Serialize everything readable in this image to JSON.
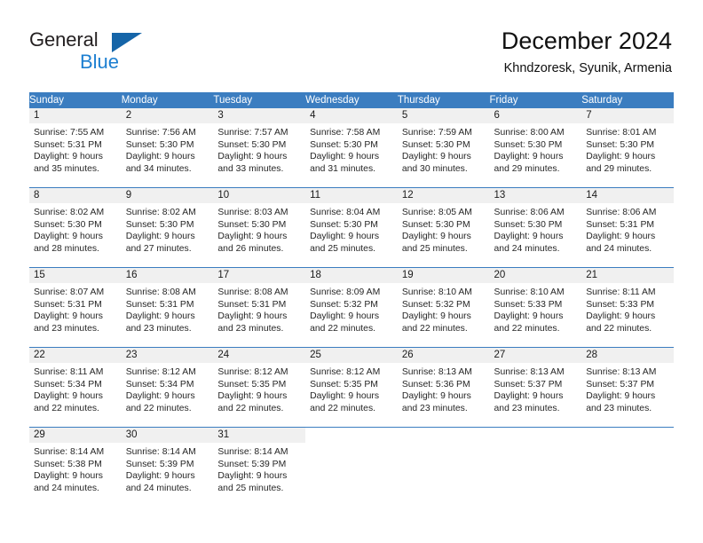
{
  "brand": {
    "line1": "General",
    "line2": "Blue",
    "triangle_icon": "blue-triangle-logo-mark",
    "color_dark": "#231f20",
    "color_blue": "#1c7fd1"
  },
  "header": {
    "title": "December 2024",
    "subtitle": "Khndzoresk, Syunik, Armenia"
  },
  "theme": {
    "header_blue": "#3b7dc0",
    "daynum_band": "#f0f0f0",
    "text": "#262626"
  },
  "weekdays": [
    "Sunday",
    "Monday",
    "Tuesday",
    "Wednesday",
    "Thursday",
    "Friday",
    "Saturday"
  ],
  "weeks": [
    [
      {
        "day": "1",
        "l1": "Sunrise: 7:55 AM",
        "l2": "Sunset: 5:31 PM",
        "l3": "Daylight: 9 hours",
        "l4": "and 35 minutes."
      },
      {
        "day": "2",
        "l1": "Sunrise: 7:56 AM",
        "l2": "Sunset: 5:30 PM",
        "l3": "Daylight: 9 hours",
        "l4": "and 34 minutes."
      },
      {
        "day": "3",
        "l1": "Sunrise: 7:57 AM",
        "l2": "Sunset: 5:30 PM",
        "l3": "Daylight: 9 hours",
        "l4": "and 33 minutes."
      },
      {
        "day": "4",
        "l1": "Sunrise: 7:58 AM",
        "l2": "Sunset: 5:30 PM",
        "l3": "Daylight: 9 hours",
        "l4": "and 31 minutes."
      },
      {
        "day": "5",
        "l1": "Sunrise: 7:59 AM",
        "l2": "Sunset: 5:30 PM",
        "l3": "Daylight: 9 hours",
        "l4": "and 30 minutes."
      },
      {
        "day": "6",
        "l1": "Sunrise: 8:00 AM",
        "l2": "Sunset: 5:30 PM",
        "l3": "Daylight: 9 hours",
        "l4": "and 29 minutes."
      },
      {
        "day": "7",
        "l1": "Sunrise: 8:01 AM",
        "l2": "Sunset: 5:30 PM",
        "l3": "Daylight: 9 hours",
        "l4": "and 29 minutes."
      }
    ],
    [
      {
        "day": "8",
        "l1": "Sunrise: 8:02 AM",
        "l2": "Sunset: 5:30 PM",
        "l3": "Daylight: 9 hours",
        "l4": "and 28 minutes."
      },
      {
        "day": "9",
        "l1": "Sunrise: 8:02 AM",
        "l2": "Sunset: 5:30 PM",
        "l3": "Daylight: 9 hours",
        "l4": "and 27 minutes."
      },
      {
        "day": "10",
        "l1": "Sunrise: 8:03 AM",
        "l2": "Sunset: 5:30 PM",
        "l3": "Daylight: 9 hours",
        "l4": "and 26 minutes."
      },
      {
        "day": "11",
        "l1": "Sunrise: 8:04 AM",
        "l2": "Sunset: 5:30 PM",
        "l3": "Daylight: 9 hours",
        "l4": "and 25 minutes."
      },
      {
        "day": "12",
        "l1": "Sunrise: 8:05 AM",
        "l2": "Sunset: 5:30 PM",
        "l3": "Daylight: 9 hours",
        "l4": "and 25 minutes."
      },
      {
        "day": "13",
        "l1": "Sunrise: 8:06 AM",
        "l2": "Sunset: 5:30 PM",
        "l3": "Daylight: 9 hours",
        "l4": "and 24 minutes."
      },
      {
        "day": "14",
        "l1": "Sunrise: 8:06 AM",
        "l2": "Sunset: 5:31 PM",
        "l3": "Daylight: 9 hours",
        "l4": "and 24 minutes."
      }
    ],
    [
      {
        "day": "15",
        "l1": "Sunrise: 8:07 AM",
        "l2": "Sunset: 5:31 PM",
        "l3": "Daylight: 9 hours",
        "l4": "and 23 minutes."
      },
      {
        "day": "16",
        "l1": "Sunrise: 8:08 AM",
        "l2": "Sunset: 5:31 PM",
        "l3": "Daylight: 9 hours",
        "l4": "and 23 minutes."
      },
      {
        "day": "17",
        "l1": "Sunrise: 8:08 AM",
        "l2": "Sunset: 5:31 PM",
        "l3": "Daylight: 9 hours",
        "l4": "and 23 minutes."
      },
      {
        "day": "18",
        "l1": "Sunrise: 8:09 AM",
        "l2": "Sunset: 5:32 PM",
        "l3": "Daylight: 9 hours",
        "l4": "and 22 minutes."
      },
      {
        "day": "19",
        "l1": "Sunrise: 8:10 AM",
        "l2": "Sunset: 5:32 PM",
        "l3": "Daylight: 9 hours",
        "l4": "and 22 minutes."
      },
      {
        "day": "20",
        "l1": "Sunrise: 8:10 AM",
        "l2": "Sunset: 5:33 PM",
        "l3": "Daylight: 9 hours",
        "l4": "and 22 minutes."
      },
      {
        "day": "21",
        "l1": "Sunrise: 8:11 AM",
        "l2": "Sunset: 5:33 PM",
        "l3": "Daylight: 9 hours",
        "l4": "and 22 minutes."
      }
    ],
    [
      {
        "day": "22",
        "l1": "Sunrise: 8:11 AM",
        "l2": "Sunset: 5:34 PM",
        "l3": "Daylight: 9 hours",
        "l4": "and 22 minutes."
      },
      {
        "day": "23",
        "l1": "Sunrise: 8:12 AM",
        "l2": "Sunset: 5:34 PM",
        "l3": "Daylight: 9 hours",
        "l4": "and 22 minutes."
      },
      {
        "day": "24",
        "l1": "Sunrise: 8:12 AM",
        "l2": "Sunset: 5:35 PM",
        "l3": "Daylight: 9 hours",
        "l4": "and 22 minutes."
      },
      {
        "day": "25",
        "l1": "Sunrise: 8:12 AM",
        "l2": "Sunset: 5:35 PM",
        "l3": "Daylight: 9 hours",
        "l4": "and 22 minutes."
      },
      {
        "day": "26",
        "l1": "Sunrise: 8:13 AM",
        "l2": "Sunset: 5:36 PM",
        "l3": "Daylight: 9 hours",
        "l4": "and 23 minutes."
      },
      {
        "day": "27",
        "l1": "Sunrise: 8:13 AM",
        "l2": "Sunset: 5:37 PM",
        "l3": "Daylight: 9 hours",
        "l4": "and 23 minutes."
      },
      {
        "day": "28",
        "l1": "Sunrise: 8:13 AM",
        "l2": "Sunset: 5:37 PM",
        "l3": "Daylight: 9 hours",
        "l4": "and 23 minutes."
      }
    ],
    [
      {
        "day": "29",
        "l1": "Sunrise: 8:14 AM",
        "l2": "Sunset: 5:38 PM",
        "l3": "Daylight: 9 hours",
        "l4": "and 24 minutes."
      },
      {
        "day": "30",
        "l1": "Sunrise: 8:14 AM",
        "l2": "Sunset: 5:39 PM",
        "l3": "Daylight: 9 hours",
        "l4": "and 24 minutes."
      },
      {
        "day": "31",
        "l1": "Sunrise: 8:14 AM",
        "l2": "Sunset: 5:39 PM",
        "l3": "Daylight: 9 hours",
        "l4": "and 25 minutes."
      },
      {
        "day": "",
        "l1": "",
        "l2": "",
        "l3": "",
        "l4": ""
      },
      {
        "day": "",
        "l1": "",
        "l2": "",
        "l3": "",
        "l4": ""
      },
      {
        "day": "",
        "l1": "",
        "l2": "",
        "l3": "",
        "l4": ""
      },
      {
        "day": "",
        "l1": "",
        "l2": "",
        "l3": "",
        "l4": ""
      }
    ]
  ]
}
